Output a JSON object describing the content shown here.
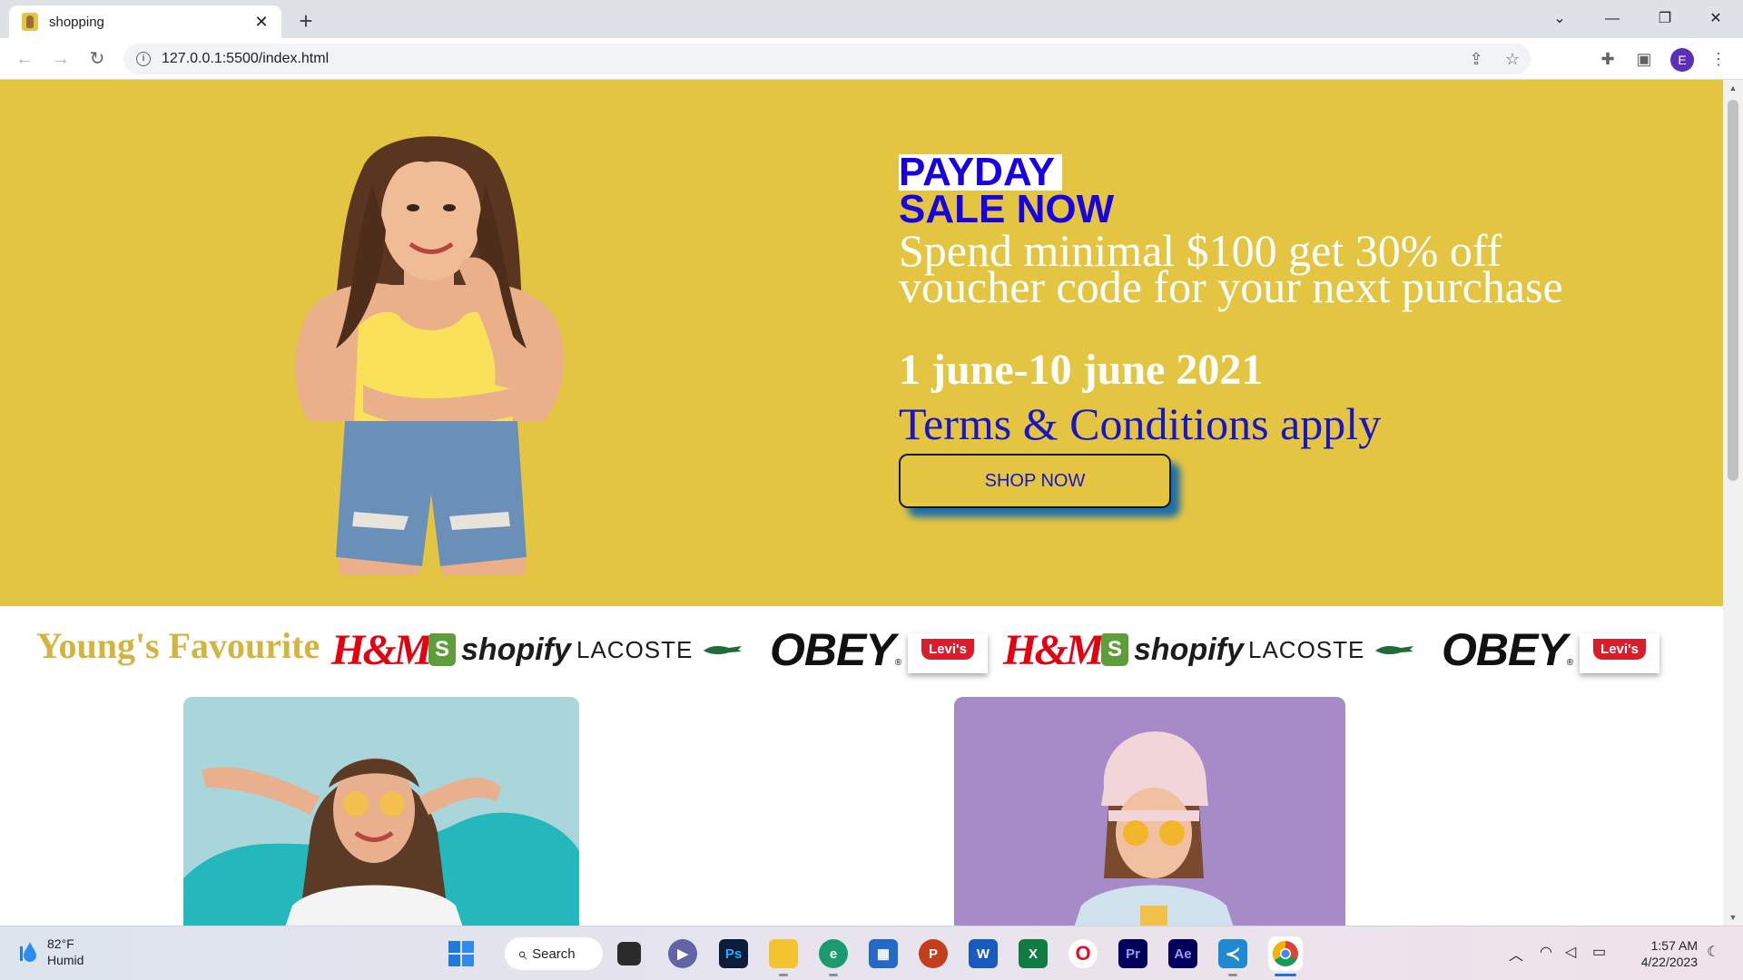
{
  "browser": {
    "tab_title": "shopping",
    "tab_close": "✕",
    "new_tab": "+",
    "url": "127.0.0.1:5500/index.html",
    "avatar_letter": "E",
    "window_controls": {
      "tab_search": "⌄",
      "minimize": "—",
      "restore": "❐",
      "close": "✕"
    }
  },
  "hero": {
    "line1": "PAYDAY",
    "line2": "SALE NOW",
    "offer_line1": "Spend minimal $100 get 30% off",
    "offer_line2": "voucher code for your next purchase",
    "dates": "1 june-10 june 2021",
    "terms": "Terms & Conditions apply",
    "cta": "SHOP NOW",
    "bg_color": "#e3c541"
  },
  "brands": {
    "heading": "Young's Favourite",
    "hm": "H&M",
    "shopify": "shopify",
    "shopify_mark": "S",
    "lacoste": "LACOSTE",
    "obey": "OBEY",
    "obey_mark": "®",
    "levis": "Levi's"
  },
  "taskbar": {
    "temp": "82°F",
    "condition": "Humid",
    "search": "Search",
    "time": "1:57 AM",
    "date": "4/22/2023",
    "apps": {
      "photoshop": "Ps",
      "powerpoint": "P",
      "word": "W",
      "excel": "X",
      "opera": "O",
      "premiere": "Pr",
      "after_effects": "Ae"
    }
  }
}
